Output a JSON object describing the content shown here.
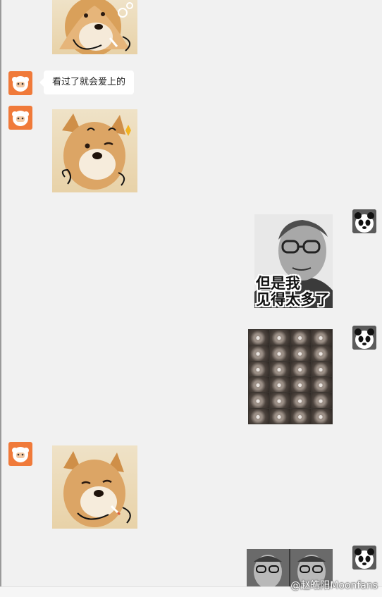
{
  "messages": [
    {
      "sender": "contact",
      "type": "sticker",
      "sticker": "doge-smoking-icon"
    },
    {
      "sender": "contact",
      "type": "text",
      "text": "看过了就会爱上的"
    },
    {
      "sender": "contact",
      "type": "sticker",
      "sticker": "doge-wink-icon"
    },
    {
      "sender": "self",
      "type": "sticker",
      "sticker": "old-man-meme-icon",
      "caption_line1": "但是我",
      "caption_line2": "见得太多了"
    },
    {
      "sender": "self",
      "type": "sticker",
      "sticker": "old-man-grid-icon"
    },
    {
      "sender": "contact",
      "type": "sticker",
      "sticker": "doge-smoking-icon"
    },
    {
      "sender": "self",
      "type": "sticker",
      "sticker": "old-man-duo-icon"
    }
  ],
  "avatars": {
    "contact": "sheep-avatar-icon",
    "self": "panda-avatar-icon"
  },
  "watermark": {
    "text": "@赵皓阳Moonfans"
  },
  "colors": {
    "background": "#f1f1f1",
    "bubble": "#ffffff",
    "contact_avatar": "#f07a3a",
    "self_avatar": "#2b2b2b"
  }
}
